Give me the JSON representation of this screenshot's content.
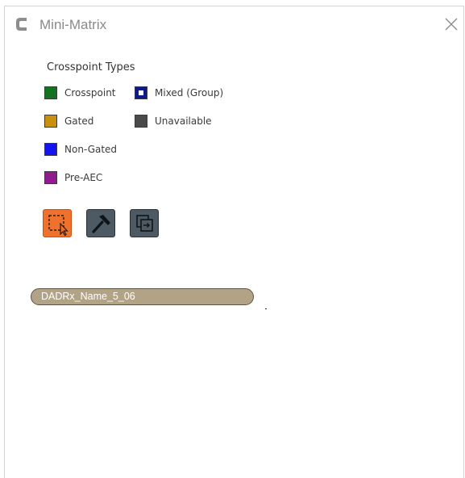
{
  "window": {
    "title": "Mini-Matrix",
    "icons": {
      "logo": "app-logo-icon",
      "close": "close-icon"
    }
  },
  "legend": {
    "title": "Crosspoint Types",
    "items": [
      {
        "label": "Crosspoint",
        "color": "#137320"
      },
      {
        "label": "Mixed (Group)",
        "color": "#0d1a8c"
      },
      {
        "label": "Gated",
        "color": "#c9900e"
      },
      {
        "label": "Unavailable",
        "color": "#4a4a4a"
      },
      {
        "label": "Non-Gated",
        "color": "#1414f0"
      },
      {
        "label": "Pre-AEC",
        "color": "#8f1b8f"
      }
    ]
  },
  "toolbar": {
    "buttons": [
      {
        "icon": "selection-tool-icon",
        "active": true,
        "color": "#f0712c"
      },
      {
        "icon": "hammer-icon",
        "active": false,
        "color": "#4e5a63"
      },
      {
        "icon": "copy-icon",
        "active": false,
        "color": "#4e5a63"
      }
    ]
  },
  "channels": [
    {
      "label": "DADRx_Name_5_06",
      "color": "#b2a286"
    }
  ]
}
